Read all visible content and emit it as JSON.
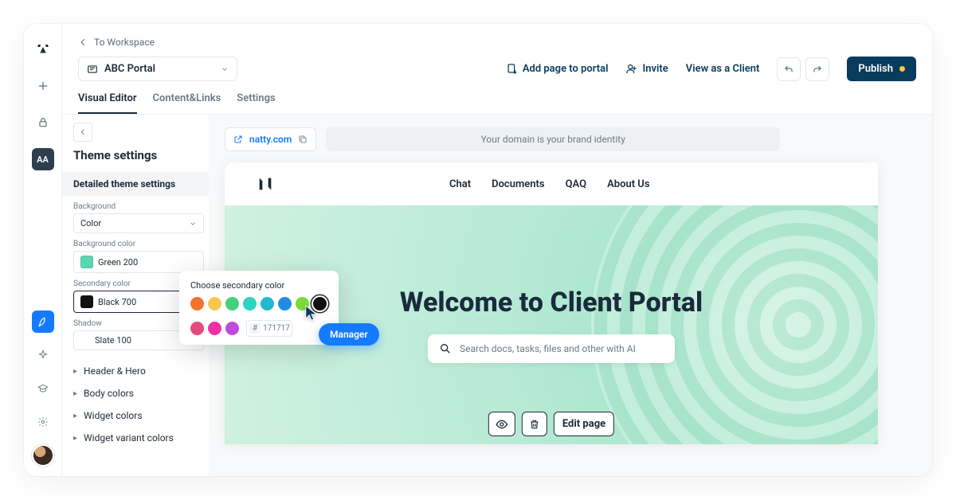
{
  "nav": {
    "back_label": "To Workspace",
    "project_name": "ABC Portal",
    "add_page": "Add page to portal",
    "invite": "Invite",
    "view_as": "View as a Client",
    "publish": "Publish"
  },
  "tabs": [
    "Visual Editor",
    "Content&Links",
    "Settings"
  ],
  "side": {
    "title": "Theme settings",
    "group": "Detailed theme settings",
    "bg_label": "Background",
    "bg_value": "Color",
    "bgcolor_label": "Background color",
    "bgcolor_value": "Green 200",
    "bgcolor_hex": "#5AD6B0",
    "sec_label": "Secondary color",
    "sec_value": "Black 700",
    "sec_hex": "#111111",
    "shadow_label": "Shadow",
    "shadow_value": "Slate 100",
    "rows": [
      "Header & Hero",
      "Body colors",
      "Widget colors",
      "Widget variant colors"
    ]
  },
  "popover": {
    "title": "Choose secondary color",
    "colors_row1": [
      "#f3722c",
      "#f9c74f",
      "#43d17a",
      "#2dd4bf",
      "#22b8cf",
      "#228be6",
      "#7bd938",
      "#111111"
    ],
    "colors_row2": [
      "#e64980",
      "#f031a5",
      "#be4bdb"
    ],
    "hex_prefix": "#",
    "hex_value": "171717",
    "selected_index": 7
  },
  "tooltip": "Manager",
  "preview": {
    "domain": "natty.com",
    "domain_hint": "Your domain is your brand identity",
    "logo": "N",
    "menu": [
      "Chat",
      "Documents",
      "QAQ",
      "About Us"
    ],
    "hero_title": "Welcome to Client Portal",
    "search_placeholder": "Search docs, tasks, files and other with AI",
    "edit_page": "Edit page"
  },
  "rail": {
    "aa": "AA"
  }
}
